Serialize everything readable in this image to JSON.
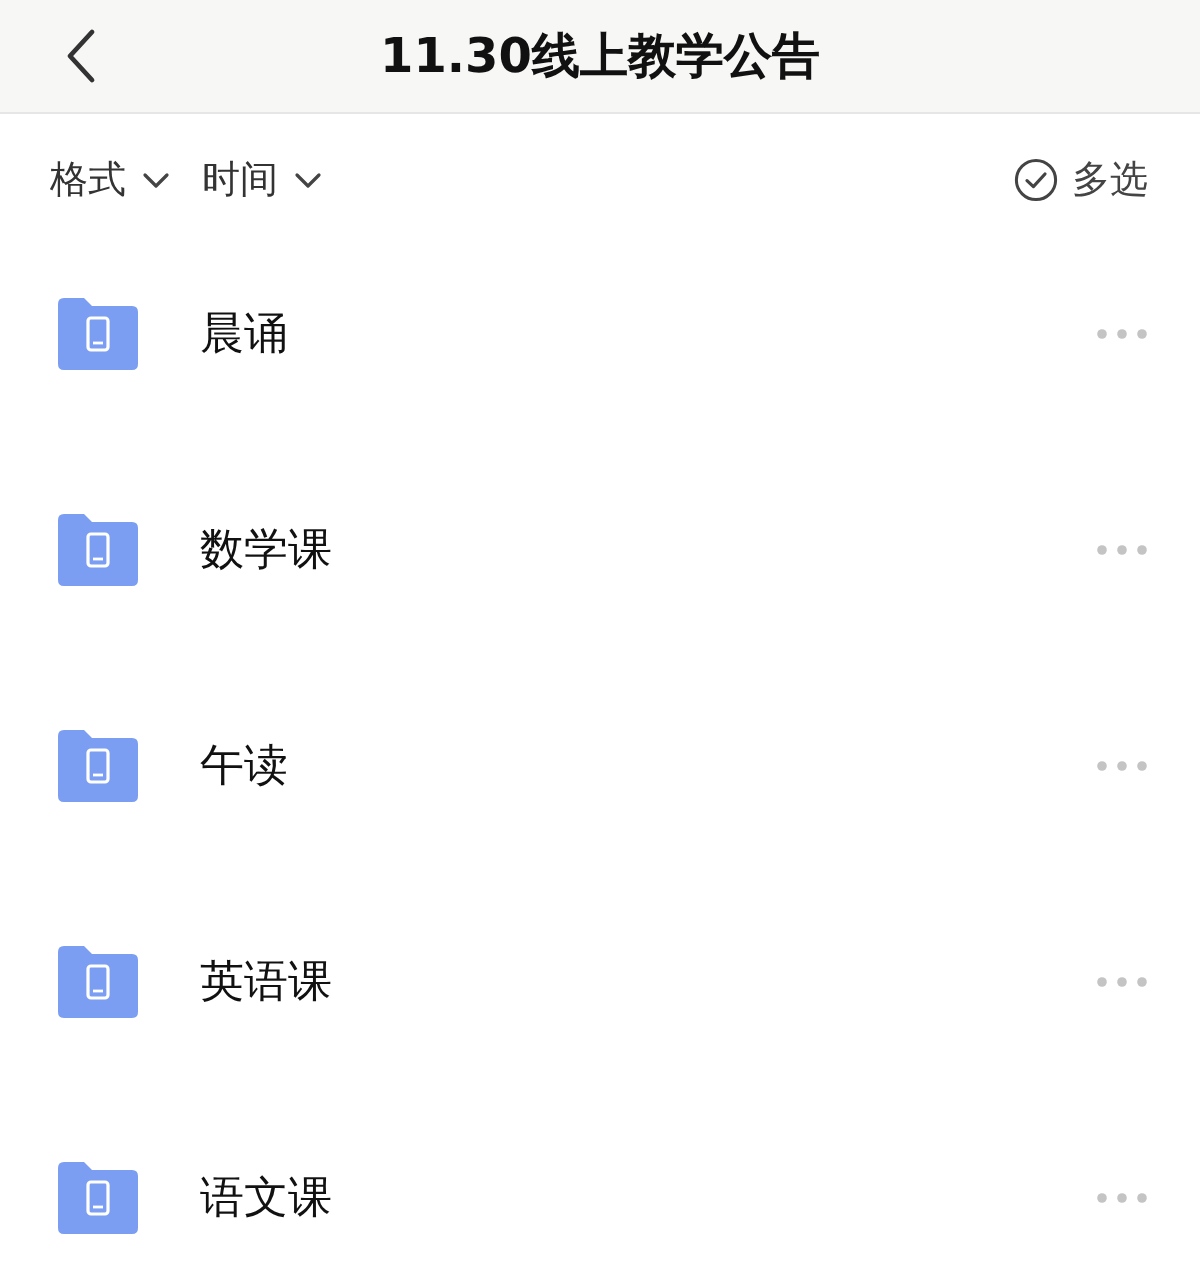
{
  "header": {
    "title": "11.30线上教学公告"
  },
  "filters": [
    {
      "label": "格式"
    },
    {
      "label": "时间"
    }
  ],
  "multi_select": {
    "label": "多选"
  },
  "folders": [
    {
      "name": "晨诵"
    },
    {
      "name": "数学课"
    },
    {
      "name": "午读"
    },
    {
      "name": "英语课"
    },
    {
      "name": "语文课"
    }
  ]
}
